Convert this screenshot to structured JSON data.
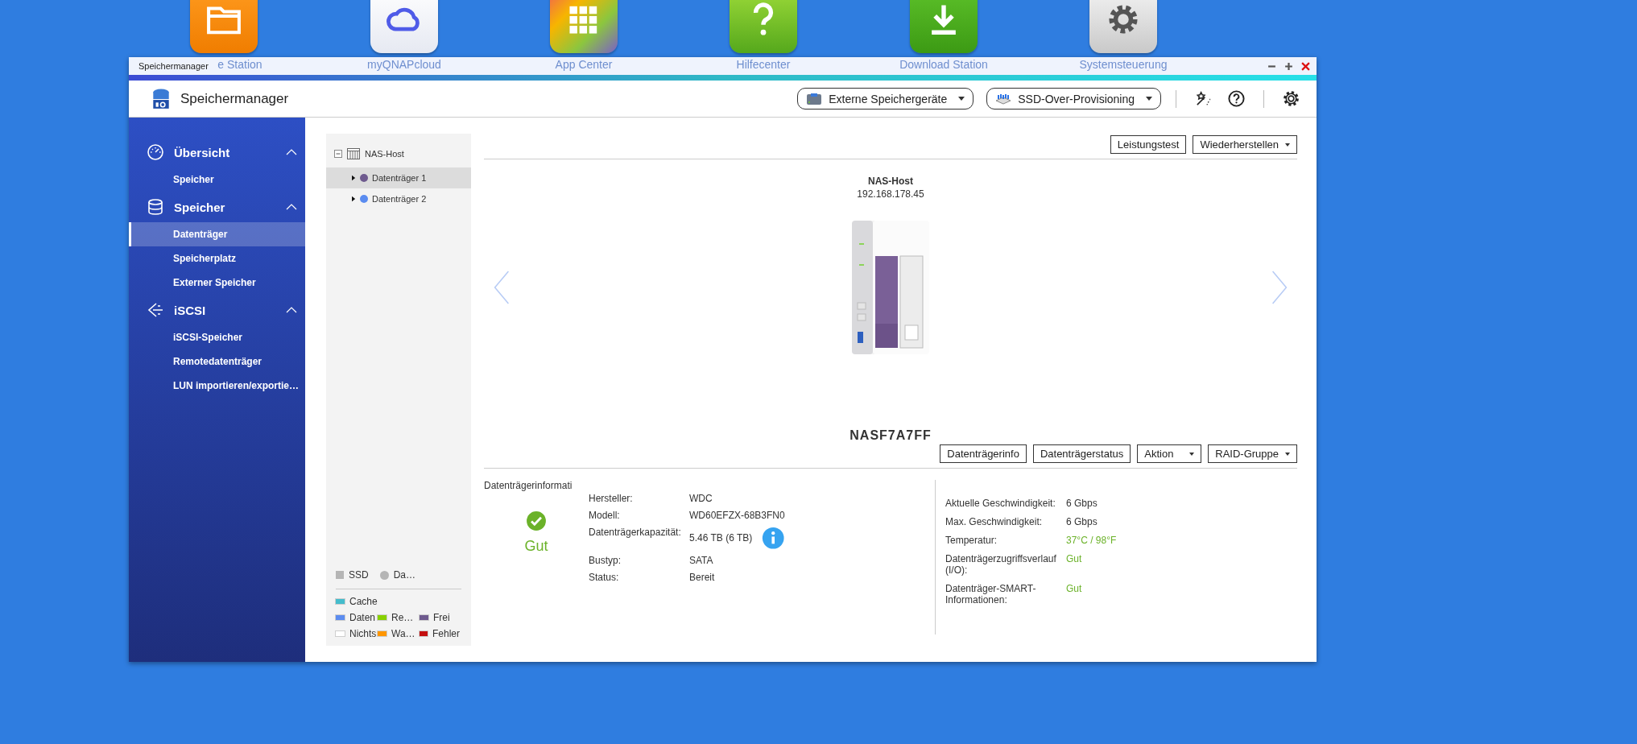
{
  "desktop_icons": [
    {
      "kind": "folder",
      "label": "e Station"
    },
    {
      "kind": "cloud",
      "label": "myQNAPcloud"
    },
    {
      "kind": "apps",
      "label": "App Center"
    },
    {
      "kind": "help",
      "label": "Hilfecenter"
    },
    {
      "kind": "download",
      "label": "Download Station"
    },
    {
      "kind": "gear",
      "label": "Systemsteuerung"
    }
  ],
  "window": {
    "title": "Speichermanager",
    "app_title": "Speichermanager"
  },
  "toolbar": [
    {
      "kind": "raid",
      "label": "Externe Speichergeräte"
    },
    {
      "kind": "ssd",
      "label": "SSD-Over-Provisioning"
    }
  ],
  "sidebar": [
    {
      "kind": "gauge",
      "label": "Übersicht",
      "expanded": true,
      "items": [
        {
          "label": "Speicher",
          "selected": false
        }
      ]
    },
    {
      "kind": "database",
      "label": "Speicher",
      "expanded": true,
      "items": [
        {
          "label": "Datenträger",
          "selected": true
        },
        {
          "label": "Speicherplatz",
          "selected": false
        },
        {
          "label": "Externer Speicher",
          "selected": false
        }
      ]
    },
    {
      "kind": "iscsi",
      "label": "iSCSI",
      "expanded": true,
      "items": [
        {
          "label": "iSCSI-Speicher",
          "selected": false
        },
        {
          "label": "Remotedatenträger",
          "selected": false
        },
        {
          "label": "LUN importieren/exportie…",
          "selected": false
        }
      ]
    }
  ],
  "tree": {
    "label": "NAS-Host",
    "expanded": true,
    "children": [
      {
        "label": "Datenträger 1",
        "color": "#6e5a8e",
        "selected": true
      },
      {
        "label": "Datenträger 2",
        "color": "#5b8cf0",
        "selected": false
      }
    ]
  },
  "legend_types": [
    {
      "kind": "square",
      "label": "SSD"
    },
    {
      "kind": "circle",
      "label": "Da…"
    }
  ],
  "legend_usage": [
    {
      "label": "Cache",
      "color": "#44bccc"
    },
    {
      "label": "Daten",
      "color": "#5b8cf0"
    },
    {
      "label": "Re…",
      "color": "#88d100"
    },
    {
      "label": "Frei",
      "color": "#6e5a8e"
    },
    {
      "label": "Nichts",
      "color": "#ffffff"
    },
    {
      "label": "Wa…",
      "color": "#ff9600"
    },
    {
      "label": "Fehler",
      "color": "#c40f0f"
    }
  ],
  "top_actions": [
    {
      "label": "Leistungstest",
      "dropdown": false
    },
    {
      "label": "Wiederherstellen",
      "dropdown": true
    }
  ],
  "device": {
    "name": "NAS-Host",
    "address": "192.168.178.45",
    "model": "NASF7A7FF"
  },
  "disk_actions": [
    {
      "label": "Datenträgerinfo",
      "dropdown": false
    },
    {
      "label": "Datenträgerstatus",
      "dropdown": false
    },
    {
      "label": "Aktion",
      "dropdown": true
    },
    {
      "label": "RAID-Gruppe",
      "dropdown": true
    }
  ],
  "info": {
    "title": "Datenträgerinformati",
    "health": "Gut",
    "left": [
      {
        "kind": "plain",
        "label": "Hersteller:",
        "value": "WDC",
        "good": false
      },
      {
        "kind": "plain",
        "label": "Modell:",
        "value": "WD60EFZX-68B3FN0",
        "good": false
      },
      {
        "kind": "with_info",
        "label": "Datenträgerkapazität:",
        "value": "5.46 TB (6 TB)",
        "good": false
      },
      {
        "kind": "plain",
        "label": "Bustyp:",
        "value": "SATA",
        "good": false
      },
      {
        "kind": "plain",
        "label": "Status:",
        "value": "Bereit",
        "good": false
      }
    ],
    "right": [
      {
        "label": "Aktuelle Geschwindigkeit:",
        "value": "6 Gbps",
        "good": false
      },
      {
        "label": "Max. Geschwindigkeit:",
        "value": "6 Gbps",
        "good": false
      },
      {
        "label": "Temperatur:",
        "value": "37°C / 98°F",
        "good": true
      },
      {
        "label": "Datenträgerzugriffsverlauf (I/O):",
        "value": "Gut",
        "good": true
      },
      {
        "label": "Datenträger-SMART-Informationen:",
        "value": "Gut",
        "good": true
      }
    ]
  }
}
